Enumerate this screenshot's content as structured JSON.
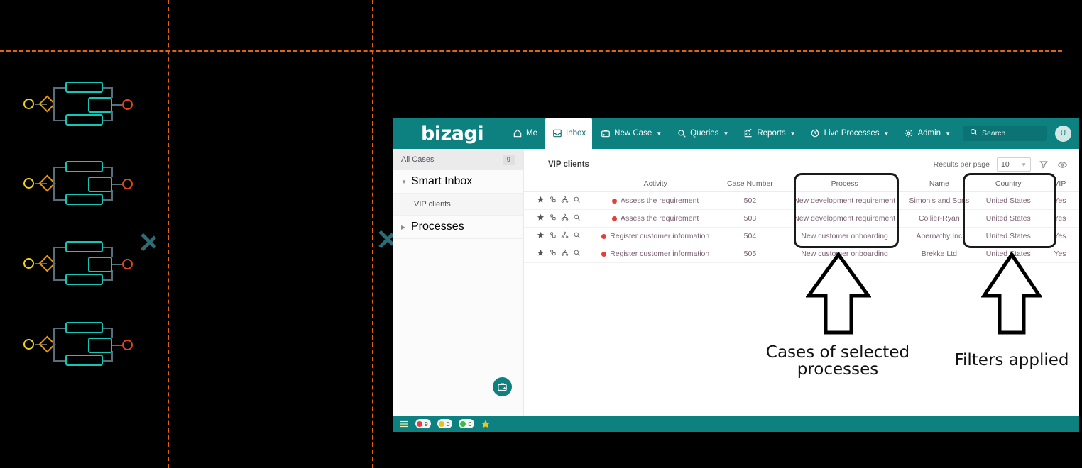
{
  "app": {
    "brand": "bizagi",
    "nav": [
      {
        "label": "Me",
        "icon": "home-icon",
        "caret": false,
        "active": false
      },
      {
        "label": "Inbox",
        "icon": "inbox-icon",
        "caret": false,
        "active": true
      },
      {
        "label": "New Case",
        "icon": "new-case-icon",
        "caret": true,
        "active": false
      },
      {
        "label": "Queries",
        "icon": "search-icon",
        "caret": true,
        "active": false
      },
      {
        "label": "Reports",
        "icon": "reports-icon",
        "caret": true,
        "active": false
      },
      {
        "label": "Live Processes",
        "icon": "live-processes-icon",
        "caret": true,
        "active": false
      },
      {
        "label": "Admin",
        "icon": "gear-icon",
        "caret": true,
        "active": false
      }
    ],
    "search": {
      "placeholder": "Search",
      "value": ""
    },
    "avatar_initial": "U"
  },
  "sidebar": {
    "all_cases": {
      "label": "All Cases",
      "count": "9"
    },
    "smart_inbox": {
      "label": "Smart Inbox",
      "expanded": true
    },
    "smart_inbox_children": [
      {
        "label": "VIP clients",
        "selected": true
      }
    ],
    "processes": {
      "label": "Processes",
      "expanded": false
    },
    "fab": {
      "name": "new-case-fab"
    }
  },
  "main": {
    "title": "VIP clients",
    "results_per_page_label": "Results per page",
    "results_per_page_value": "10",
    "filter_icon": "filter-icon",
    "visibility_icon": "eye-icon",
    "columns": [
      "",
      "Activity",
      "Case Number",
      "Process",
      "Name",
      "Country",
      "VIP"
    ],
    "rows": [
      {
        "activity": "Assess the requirement",
        "case_number": "502",
        "process": "New development requirement",
        "name": "Simonis and Sons",
        "country": "United States",
        "vip": "Yes"
      },
      {
        "activity": "Assess the requirement",
        "case_number": "503",
        "process": "New development requirement",
        "name": "Collier-Ryan",
        "country": "United States",
        "vip": "Yes"
      },
      {
        "activity": "Register customer information",
        "case_number": "504",
        "process": "New customer onboarding",
        "name": "Abernathy Inc",
        "country": "United States",
        "vip": "Yes"
      },
      {
        "activity": "Register customer information",
        "case_number": "505",
        "process": "New customer onboarding",
        "name": "Brekke Ltd",
        "country": "United States",
        "vip": "Yes"
      }
    ],
    "row_icons": [
      "star-icon",
      "assign-user-icon",
      "workflow-icon",
      "magnifier-icon"
    ]
  },
  "statusbar": {
    "menu_icon": "list-menu-icon",
    "pills": [
      {
        "color": "#ea3b3b",
        "count": "9"
      },
      {
        "color": "#e8c21a",
        "count": "0"
      },
      {
        "color": "#3bbf3b",
        "count": "0"
      }
    ],
    "star_icon": "star-icon"
  },
  "annotations": [
    {
      "text_line1": "Cases of selected",
      "text_line2": "processes",
      "name": "annotation-cases-of-selected-processes"
    },
    {
      "text_line1": "Filters applied",
      "text_line2": "",
      "name": "annotation-filters-applied"
    }
  ],
  "colors": {
    "brand_teal": "#0d8080",
    "accent_link": "#3f9a9a",
    "status_red": "#ea3b3b",
    "guide_orange": "#e2620f",
    "bpmn_task": "#13c7b4",
    "bpmn_start": "#f2d21a",
    "bpmn_gateway": "#e8960f",
    "bpmn_end": "#e2470f"
  }
}
